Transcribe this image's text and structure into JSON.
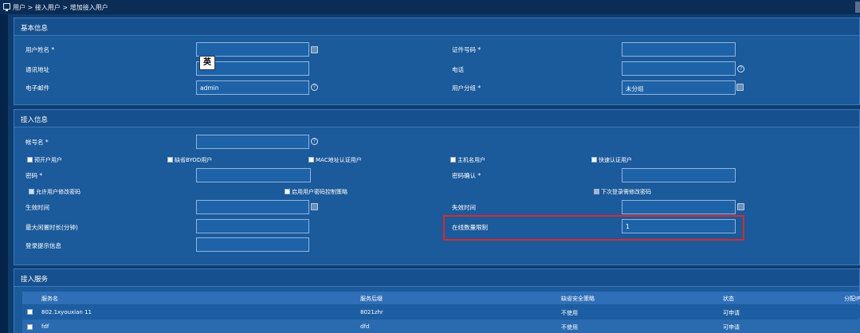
{
  "breadcrumb": "用户 > 接入用户 > 增加接入用户",
  "ime_indicator": "英",
  "basic": {
    "title": "基本信息",
    "user_name_label": "用户姓名 *",
    "user_name_value": "",
    "cert_no_label": "证件号码 *",
    "cert_no_value": "",
    "address_label": "通讯地址",
    "address_value": "",
    "phone_label": "电话",
    "phone_value": "",
    "email_label": "电子邮件",
    "email_value": "admin",
    "group_label": "用户分组 *",
    "group_value": "未分组"
  },
  "access": {
    "title": "接入信息",
    "account_label": "帐号名 *",
    "account_value": "",
    "checks": {
      "prepaid": "预开户用户",
      "byod": "缺省BYOD用户",
      "mac": "MAC地址认证用户",
      "hostname": "主机名用户",
      "fast": "快速认证用户"
    },
    "password_label": "密码 *",
    "password_confirm_label": "密码确认 *",
    "allow_change": "允许用户修改密码",
    "enable_pw_policy": "启用用户密码控制策略",
    "next_login_change": "下次登录需修改密码",
    "effective_label": "生效时间",
    "expire_label": "失效时间",
    "max_idle_label": "最大闲置时长(分钟)",
    "online_limit_label": "在线数量限制",
    "online_limit_value": "1",
    "login_msg_label": "登录提示信息"
  },
  "service": {
    "title": "接入服务",
    "columns": [
      "服务名",
      "服务后缀",
      "缺省安全策略",
      "状态",
      "分配IP"
    ],
    "rows": [
      {
        "name": "802.1xyouxian 11",
        "suffix": "8021zhr",
        "policy": "不使用",
        "status": "可申请"
      },
      {
        "name": "fdf",
        "suffix": "dfd",
        "policy": "不使用",
        "status": "可申请"
      }
    ]
  }
}
